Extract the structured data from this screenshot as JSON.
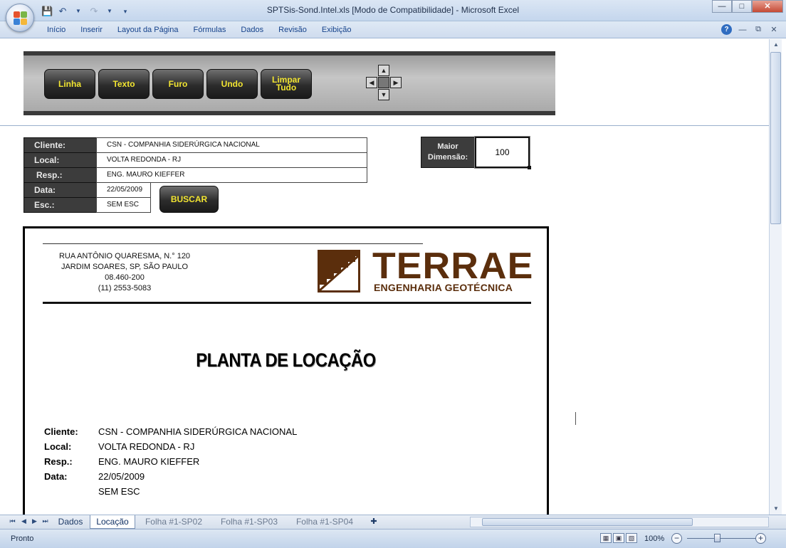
{
  "window": {
    "title": "SPTSis-Sond.Intel.xls  [Modo de Compatibilidade] - Microsoft Excel",
    "controls": [
      "minimize",
      "maximize",
      "close"
    ]
  },
  "ribbon": {
    "tabs": [
      "Início",
      "Inserir",
      "Layout da Página",
      "Fórmulas",
      "Dados",
      "Revisão",
      "Exibição"
    ]
  },
  "toolbar": {
    "buttons": [
      "Linha",
      "Texto",
      "Furo",
      "Undo",
      "Limpar Tudo"
    ]
  },
  "form": {
    "cliente_label": "Cliente:",
    "cliente": "CSN - COMPANHIA SIDERÚRGICA NACIONAL",
    "local_label": "Local:",
    "local": "VOLTA REDONDA - RJ",
    "resp_label": "Resp.:",
    "resp": "ENG. MAURO KIEFFER",
    "data_label": "Data:",
    "data": "22/05/2009",
    "esc_label": "Esc.:",
    "esc": "SEM ESC",
    "buscar": "BUSCAR",
    "maior_label_1": "Maior",
    "maior_label_2": "Dimensão:",
    "maior_value": "100"
  },
  "report": {
    "address": [
      "RUA ANTÔNIO QUARESMA, N.° 120",
      "JARDIM SOARES, SP, SÃO PAULO",
      "08.460-200",
      "(11) 2553-5083"
    ],
    "logo_main": "TERRAE",
    "logo_sub": "ENGENHARIA GEOTÉCNICA",
    "title": "PLANTA DE LOCAÇÃO",
    "cliente_label": "Cliente:",
    "cliente": "CSN - COMPANHIA SIDERÚRGICA NACIONAL",
    "local_label": "Local:",
    "local": "VOLTA REDONDA - RJ",
    "resp_label": "Resp.:",
    "resp": "ENG. MAURO KIEFFER",
    "data_label": "Data:",
    "data": "22/05/2009",
    "esc": "SEM ESC"
  },
  "sheet_tabs": [
    "Dados",
    "Locação",
    "Folha #1-SP02",
    "Folha #1-SP03",
    "Folha #1-SP04"
  ],
  "active_sheet": "Locação",
  "status": {
    "text": "Pronto",
    "zoom": "100%"
  },
  "colors": {
    "button_text": "#f2e531",
    "label_bg": "#3c3c3c",
    "logo_brown": "#5b2e0c"
  }
}
